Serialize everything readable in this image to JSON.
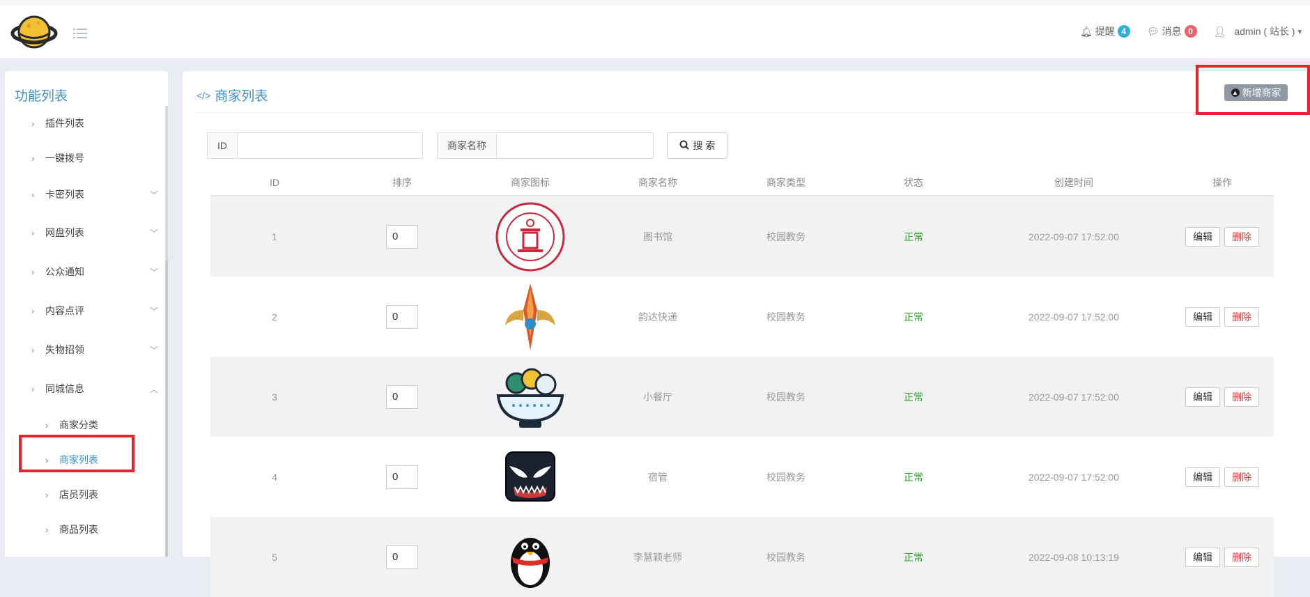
{
  "header": {
    "remind_label": "提醒",
    "remind_count": "4",
    "message_label": "消息",
    "message_count": "0",
    "user_label": "admin ( 站长 )"
  },
  "sidebar": {
    "title": "功能列表",
    "items": [
      {
        "label": "插件列表"
      },
      {
        "label": "一键拨号"
      },
      {
        "label": "卡密列表"
      },
      {
        "label": "网盘列表"
      },
      {
        "label": "公众通知"
      },
      {
        "label": "内容点评"
      },
      {
        "label": "失物招领"
      },
      {
        "label": "同城信息"
      }
    ],
    "subitems": [
      {
        "label": "商家分类"
      },
      {
        "label": "商家列表"
      },
      {
        "label": "店员列表"
      },
      {
        "label": "商品列表"
      }
    ]
  },
  "main": {
    "title": "商家列表",
    "add_button": "新增商家",
    "search": {
      "id_label": "ID",
      "name_label": "商家名称",
      "button": "搜 索"
    },
    "columns": [
      "ID",
      "排序",
      "商家图标",
      "商家名称",
      "商家类型",
      "状态",
      "创建时间",
      "操作"
    ],
    "rows": [
      {
        "id": "1",
        "sort": "0",
        "icon": "university-seal-icon",
        "name": "图书馆",
        "type": "校园教务",
        "status": "正常",
        "created": "2022-09-07 17:52:00"
      },
      {
        "id": "2",
        "sort": "0",
        "icon": "sword-emblem-icon",
        "name": "韵达快递",
        "type": "校园教务",
        "status": "正常",
        "created": "2022-09-07 17:52:00"
      },
      {
        "id": "3",
        "sort": "0",
        "icon": "food-bowl-icon",
        "name": "小餐厅",
        "type": "校园教务",
        "status": "正常",
        "created": "2022-09-07 17:52:00"
      },
      {
        "id": "4",
        "sort": "0",
        "icon": "venom-face-icon",
        "name": "宿管",
        "type": "校园教务",
        "status": "正常",
        "created": "2022-09-07 17:52:00"
      },
      {
        "id": "5",
        "sort": "0",
        "icon": "penguin-icon",
        "name": "李慧颖老师",
        "type": "校园教务",
        "status": "正常",
        "created": "2022-09-08 10:13:19"
      }
    ],
    "edit_label": "编辑",
    "delete_label": "删除"
  }
}
